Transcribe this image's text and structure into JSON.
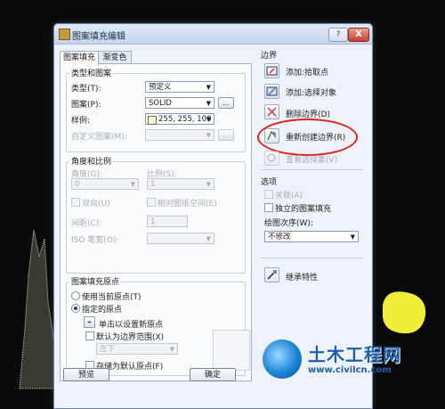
{
  "window": {
    "title": "图案填充编辑",
    "help_label": "?",
    "close_label": "X"
  },
  "tabs": [
    {
      "label": "图案填充"
    },
    {
      "label": "渐变色"
    }
  ],
  "type_group": {
    "title": "类型和图案",
    "type_label": "类型(T):",
    "type_value": "预定义",
    "pattern_label": "图案(P):",
    "pattern_value": "SOLID",
    "swatch_label": "样例:",
    "swatch_value": "255, 255, 100",
    "custom_label": "自定义图案(M):",
    "ellipsis": "..."
  },
  "angle_group": {
    "title": "角度和比例",
    "angle_label": "角度(G):",
    "angle_value": "0",
    "scale_label": "比例(S):",
    "scale_value": "1",
    "double_label": "双向(U)",
    "relative_label": "相对图纸空间(E)",
    "spacing_label": "间距(C):",
    "spacing_value": "1",
    "iso_label": "ISO 笔宽(O):"
  },
  "origin_group": {
    "title": "图案填充原点",
    "use_current_label": "使用当前原点(T)",
    "specified_label": "指定的原点",
    "click_set_label": "单击以设置新原点",
    "default_extent_label": "默认为边界范围(X)",
    "position_value": "左下",
    "store_default_label": "存储为默认原点(F)"
  },
  "boundary": {
    "title": "边界",
    "add_pick_label": "添加:拾取点",
    "add_select_label": "添加:选择对象",
    "remove_label": "删除边界(D)",
    "recreate_label": "重新创建边界(R)",
    "view_label": "查看选择集(V)"
  },
  "options": {
    "title": "选项",
    "associative_label": "关联(A)",
    "independent_label": "独立的图案填充",
    "draw_order_label": "绘图次序(W):",
    "draw_order_value": "不修改"
  },
  "inherit_label": "继承特性",
  "buttons": {
    "preview_label": "预览",
    "ok_label": "确定"
  },
  "watermark": {
    "brand": "土木工程网",
    "url": "www.civilcn.com"
  },
  "colors": {
    "highlight_oval": "#e0241b",
    "sample_swatch": "#ffffcc",
    "watermark": "#1b5fb3"
  }
}
